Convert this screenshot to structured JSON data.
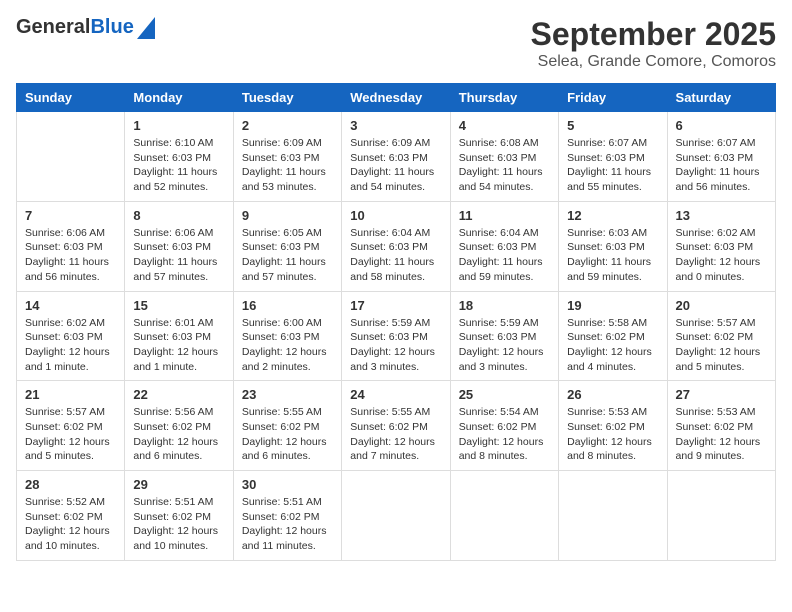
{
  "header": {
    "logo_general": "General",
    "logo_blue": "Blue",
    "title": "September 2025",
    "subtitle": "Selea, Grande Comore, Comoros"
  },
  "calendar": {
    "days_of_week": [
      "Sunday",
      "Monday",
      "Tuesday",
      "Wednesday",
      "Thursday",
      "Friday",
      "Saturday"
    ],
    "weeks": [
      [
        {
          "day": "",
          "info": ""
        },
        {
          "day": "1",
          "info": "Sunrise: 6:10 AM\nSunset: 6:03 PM\nDaylight: 11 hours\nand 52 minutes."
        },
        {
          "day": "2",
          "info": "Sunrise: 6:09 AM\nSunset: 6:03 PM\nDaylight: 11 hours\nand 53 minutes."
        },
        {
          "day": "3",
          "info": "Sunrise: 6:09 AM\nSunset: 6:03 PM\nDaylight: 11 hours\nand 54 minutes."
        },
        {
          "day": "4",
          "info": "Sunrise: 6:08 AM\nSunset: 6:03 PM\nDaylight: 11 hours\nand 54 minutes."
        },
        {
          "day": "5",
          "info": "Sunrise: 6:07 AM\nSunset: 6:03 PM\nDaylight: 11 hours\nand 55 minutes."
        },
        {
          "day": "6",
          "info": "Sunrise: 6:07 AM\nSunset: 6:03 PM\nDaylight: 11 hours\nand 56 minutes."
        }
      ],
      [
        {
          "day": "7",
          "info": "Sunrise: 6:06 AM\nSunset: 6:03 PM\nDaylight: 11 hours\nand 56 minutes."
        },
        {
          "day": "8",
          "info": "Sunrise: 6:06 AM\nSunset: 6:03 PM\nDaylight: 11 hours\nand 57 minutes."
        },
        {
          "day": "9",
          "info": "Sunrise: 6:05 AM\nSunset: 6:03 PM\nDaylight: 11 hours\nand 57 minutes."
        },
        {
          "day": "10",
          "info": "Sunrise: 6:04 AM\nSunset: 6:03 PM\nDaylight: 11 hours\nand 58 minutes."
        },
        {
          "day": "11",
          "info": "Sunrise: 6:04 AM\nSunset: 6:03 PM\nDaylight: 11 hours\nand 59 minutes."
        },
        {
          "day": "12",
          "info": "Sunrise: 6:03 AM\nSunset: 6:03 PM\nDaylight: 11 hours\nand 59 minutes."
        },
        {
          "day": "13",
          "info": "Sunrise: 6:02 AM\nSunset: 6:03 PM\nDaylight: 12 hours\nand 0 minutes."
        }
      ],
      [
        {
          "day": "14",
          "info": "Sunrise: 6:02 AM\nSunset: 6:03 PM\nDaylight: 12 hours\nand 1 minute."
        },
        {
          "day": "15",
          "info": "Sunrise: 6:01 AM\nSunset: 6:03 PM\nDaylight: 12 hours\nand 1 minute."
        },
        {
          "day": "16",
          "info": "Sunrise: 6:00 AM\nSunset: 6:03 PM\nDaylight: 12 hours\nand 2 minutes."
        },
        {
          "day": "17",
          "info": "Sunrise: 5:59 AM\nSunset: 6:03 PM\nDaylight: 12 hours\nand 3 minutes."
        },
        {
          "day": "18",
          "info": "Sunrise: 5:59 AM\nSunset: 6:03 PM\nDaylight: 12 hours\nand 3 minutes."
        },
        {
          "day": "19",
          "info": "Sunrise: 5:58 AM\nSunset: 6:02 PM\nDaylight: 12 hours\nand 4 minutes."
        },
        {
          "day": "20",
          "info": "Sunrise: 5:57 AM\nSunset: 6:02 PM\nDaylight: 12 hours\nand 5 minutes."
        }
      ],
      [
        {
          "day": "21",
          "info": "Sunrise: 5:57 AM\nSunset: 6:02 PM\nDaylight: 12 hours\nand 5 minutes."
        },
        {
          "day": "22",
          "info": "Sunrise: 5:56 AM\nSunset: 6:02 PM\nDaylight: 12 hours\nand 6 minutes."
        },
        {
          "day": "23",
          "info": "Sunrise: 5:55 AM\nSunset: 6:02 PM\nDaylight: 12 hours\nand 6 minutes."
        },
        {
          "day": "24",
          "info": "Sunrise: 5:55 AM\nSunset: 6:02 PM\nDaylight: 12 hours\nand 7 minutes."
        },
        {
          "day": "25",
          "info": "Sunrise: 5:54 AM\nSunset: 6:02 PM\nDaylight: 12 hours\nand 8 minutes."
        },
        {
          "day": "26",
          "info": "Sunrise: 5:53 AM\nSunset: 6:02 PM\nDaylight: 12 hours\nand 8 minutes."
        },
        {
          "day": "27",
          "info": "Sunrise: 5:53 AM\nSunset: 6:02 PM\nDaylight: 12 hours\nand 9 minutes."
        }
      ],
      [
        {
          "day": "28",
          "info": "Sunrise: 5:52 AM\nSunset: 6:02 PM\nDaylight: 12 hours\nand 10 minutes."
        },
        {
          "day": "29",
          "info": "Sunrise: 5:51 AM\nSunset: 6:02 PM\nDaylight: 12 hours\nand 10 minutes."
        },
        {
          "day": "30",
          "info": "Sunrise: 5:51 AM\nSunset: 6:02 PM\nDaylight: 12 hours\nand 11 minutes."
        },
        {
          "day": "",
          "info": ""
        },
        {
          "day": "",
          "info": ""
        },
        {
          "day": "",
          "info": ""
        },
        {
          "day": "",
          "info": ""
        }
      ]
    ]
  }
}
